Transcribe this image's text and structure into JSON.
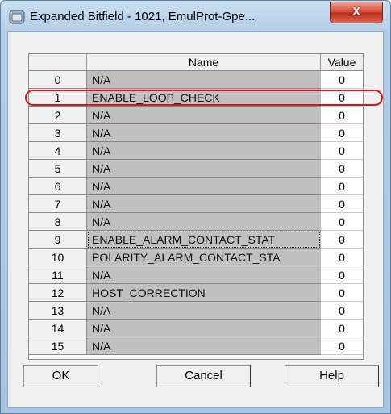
{
  "window": {
    "title": "Expanded Bitfield - 1021, EmulProt-Gpe...",
    "close_label": "X"
  },
  "table": {
    "headers": [
      "",
      "Name",
      "Value"
    ],
    "rows": [
      {
        "index": "0",
        "name": "N/A",
        "value": "0"
      },
      {
        "index": "1",
        "name": "ENABLE_LOOP_CHECK",
        "value": "0"
      },
      {
        "index": "2",
        "name": "N/A",
        "value": "0"
      },
      {
        "index": "3",
        "name": "N/A",
        "value": "0"
      },
      {
        "index": "4",
        "name": "N/A",
        "value": "0"
      },
      {
        "index": "5",
        "name": "N/A",
        "value": "0"
      },
      {
        "index": "6",
        "name": "N/A",
        "value": "0"
      },
      {
        "index": "7",
        "name": "N/A",
        "value": "0"
      },
      {
        "index": "8",
        "name": "N/A",
        "value": "0"
      },
      {
        "index": "9",
        "name": "ENABLE_ALARM_CONTACT_STAT",
        "value": "0"
      },
      {
        "index": "10",
        "name": "POLARITY_ALARM_CONTACT_STA",
        "value": "0"
      },
      {
        "index": "11",
        "name": "N/A",
        "value": "0"
      },
      {
        "index": "12",
        "name": "HOST_CORRECTION",
        "value": "0"
      },
      {
        "index": "13",
        "name": "N/A",
        "value": "0"
      },
      {
        "index": "14",
        "name": "N/A",
        "value": "0"
      },
      {
        "index": "15",
        "name": "N/A",
        "value": "0"
      }
    ]
  },
  "buttons": {
    "ok": "OK",
    "cancel": "Cancel",
    "help": "Help"
  },
  "colors": {
    "highlight_ring": "#e0101a",
    "name_cell_bg": "#c0c0c0"
  }
}
